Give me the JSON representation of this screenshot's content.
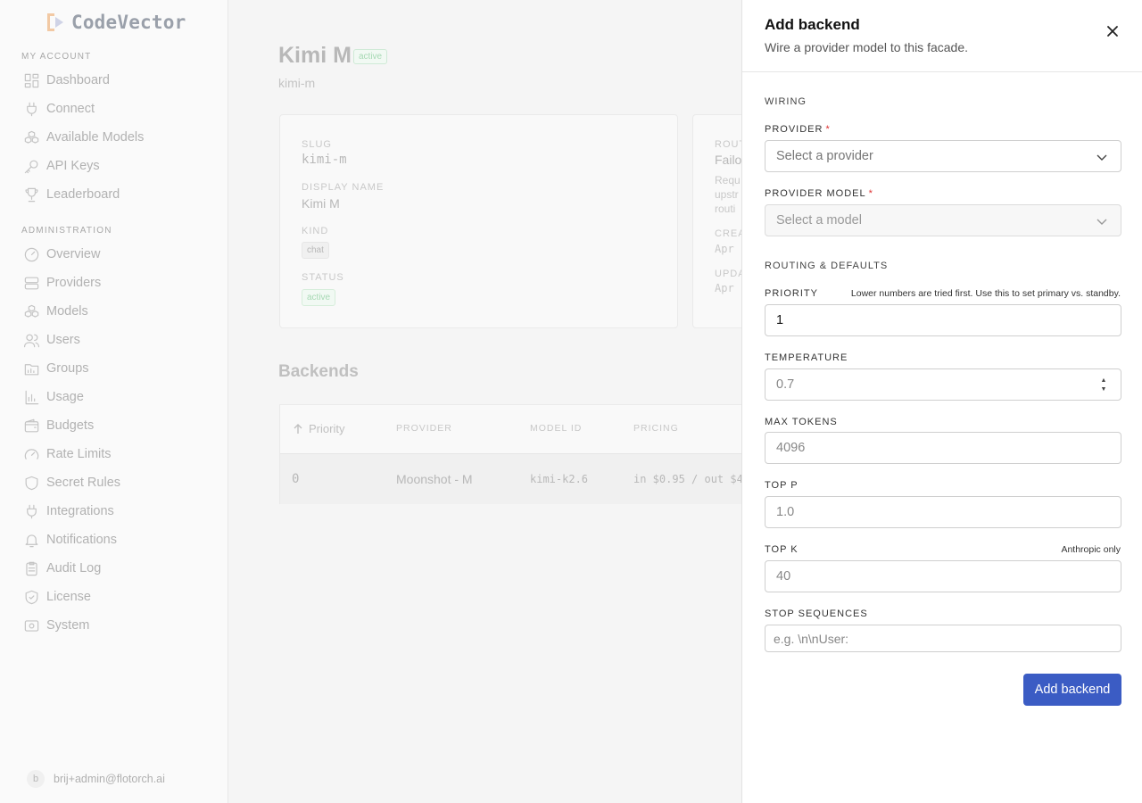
{
  "app": {
    "name": "CodeVector"
  },
  "sidebar": {
    "my_account_label": "MY ACCOUNT",
    "my_account": [
      {
        "label": "Dashboard",
        "icon": "dashboard-icon"
      },
      {
        "label": "Connect",
        "icon": "plug-icon"
      },
      {
        "label": "Available Models",
        "icon": "cubes-icon"
      },
      {
        "label": "API Keys",
        "icon": "key-icon"
      },
      {
        "label": "Leaderboard",
        "icon": "trophy-icon"
      }
    ],
    "admin_label": "ADMINISTRATION",
    "admin": [
      {
        "label": "Overview",
        "icon": "gauge-icon"
      },
      {
        "label": "Providers",
        "icon": "server-icon"
      },
      {
        "label": "Models",
        "icon": "cubes-icon"
      },
      {
        "label": "Users",
        "icon": "users-icon"
      },
      {
        "label": "Groups",
        "icon": "folder-icon"
      },
      {
        "label": "Usage",
        "icon": "bar-chart-icon"
      },
      {
        "label": "Budgets",
        "icon": "wallet-icon"
      },
      {
        "label": "Rate Limits",
        "icon": "speedometer-icon"
      },
      {
        "label": "Secret Rules",
        "icon": "shield-icon"
      },
      {
        "label": "Integrations",
        "icon": "plug-icon"
      },
      {
        "label": "Notifications",
        "icon": "bell-icon"
      },
      {
        "label": "Audit Log",
        "icon": "clipboard-icon"
      },
      {
        "label": "License",
        "icon": "shield-check-icon"
      },
      {
        "label": "System",
        "icon": "settings-icon"
      }
    ],
    "user": {
      "initial": "b",
      "email": "brij+admin@flotorch.ai"
    }
  },
  "main": {
    "title": "Kimi M",
    "title_badge": "active",
    "subtitle": "kimi-m",
    "details": {
      "slug_label": "SLUG",
      "slug": "kimi-m",
      "display_name_label": "DISPLAY NAME",
      "display_name": "Kimi M",
      "kind_label": "KIND",
      "kind": "chat",
      "status_label": "STATUS",
      "status": "active"
    },
    "routing": {
      "label": "ROUT",
      "value": "Failo",
      "desc_lines": [
        "Requ",
        "upstr",
        "routi"
      ],
      "created_label": "CREA",
      "created_value": "Apr",
      "updated_label": "UPDA",
      "updated_value": "Apr"
    },
    "backends_title": "Backends",
    "table": {
      "headers": {
        "priority": "Priority",
        "provider": "PROVIDER",
        "model_id": "MODEL ID",
        "pricing": "PRICING"
      },
      "rows": [
        {
          "priority": "0",
          "provider": "Moonshot - M",
          "model_id": "kimi-k2.6",
          "pricing": "in $0.95 / out $4"
        }
      ]
    }
  },
  "drawer": {
    "title": "Add backend",
    "subtitle": "Wire a provider model to this facade.",
    "wiring_label": "WIRING",
    "provider_label": "PROVIDER",
    "provider_placeholder": "Select a provider",
    "model_label": "PROVIDER MODEL",
    "model_placeholder": "Select a model",
    "required_mark": "*",
    "routing_label": "ROUTING & DEFAULTS",
    "priority_label": "PRIORITY",
    "priority_hint": "Lower numbers are tried first. Use this to set primary vs. standby.",
    "priority_value": "1",
    "temperature_label": "TEMPERATURE",
    "temperature_placeholder": "0.7",
    "max_tokens_label": "MAX TOKENS",
    "max_tokens_placeholder": "4096",
    "top_p_label": "TOP P",
    "top_p_placeholder": "1.0",
    "top_k_label": "TOP K",
    "top_k_hint": "Anthropic only",
    "top_k_placeholder": "40",
    "stop_label": "STOP SEQUENCES",
    "stop_placeholder": "e.g. \\n\\nUser:",
    "submit_label": "Add backend"
  },
  "colors": {
    "accent": "#3b5cc4",
    "required": "#dd3333",
    "success": "#a7d9b4"
  }
}
